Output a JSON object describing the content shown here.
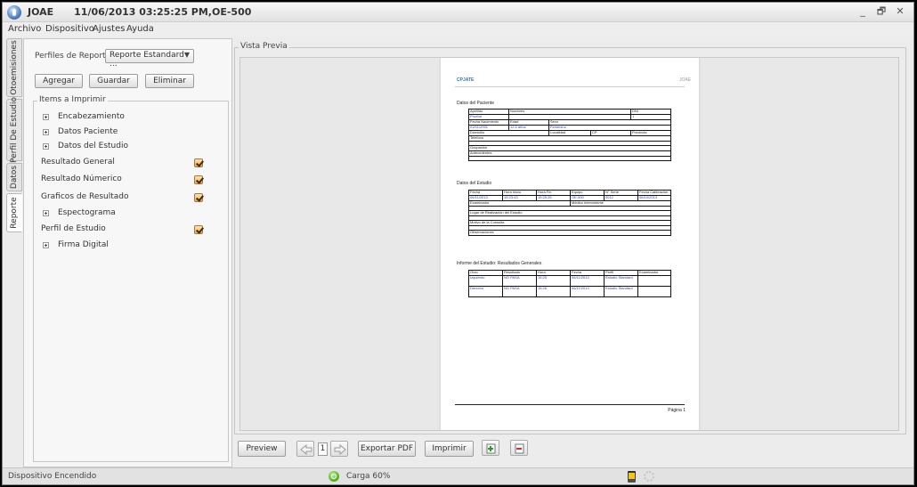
{
  "window": {
    "title": "JOAE      11/06/2013 03:25:25 PM,OE-500",
    "buttons": {
      "minimize": "_",
      "restore": "🗗",
      "close": "✕"
    }
  },
  "menu": [
    "Archivo",
    "Dispositivo",
    "Ajustes",
    "Ayuda"
  ],
  "side_tabs": [
    "Otoemisiones",
    "Perfil De Estudio",
    "Datos",
    "Reporte"
  ],
  "left_panel": {
    "profiles_label": "Perfiles de Reporte",
    "profile_selected": "Reporte Estandard ...",
    "buttons": {
      "add": "Agregar",
      "save": "Guardar",
      "delete": "Eliminar"
    },
    "items_group_title": "Items a Imprimir",
    "items": [
      {
        "label": "Encabezamiento",
        "type": "node"
      },
      {
        "label": "Datos Paciente",
        "type": "node"
      },
      {
        "label": "Datos del Estudio",
        "type": "node"
      },
      {
        "label": "Resultado General",
        "type": "check",
        "checked": true
      },
      {
        "label": "Resultado Númerico",
        "type": "check",
        "checked": true
      },
      {
        "label": "Graficos de Resultado",
        "type": "check",
        "checked": true
      },
      {
        "label": "Espectograma",
        "type": "node"
      },
      {
        "label": "Perfil de Estudio",
        "type": "check",
        "checked": true
      },
      {
        "label": "Firma Digital",
        "type": "node"
      }
    ]
  },
  "preview": {
    "title": "Vista Previa",
    "report": {
      "logo": "CPJATE",
      "logo_right": "JOAE",
      "patient_section": "Datos del Paciente",
      "patient": {
        "r1": [
          "Apellido",
          "Nombres",
          "DNI"
        ],
        "r2": [
          "Prueba",
          "",
          "1"
        ],
        "r3": [
          "Fecha Nacimiento",
          "Edad",
          "Sexo"
        ],
        "r4": [
          "01/01/2001",
          "12.5 años",
          "Femenino"
        ],
        "r5": [
          "Domicilio",
          "Localidad",
          "CP",
          "Provincia"
        ],
        "telefono": "Telefono",
        "ocupacion": "Ocupación",
        "antecedentes": "Antecedentes"
      },
      "study_section": "Datos del Estudio",
      "study": {
        "headers": [
          "Fecha",
          "Hora Inicio",
          "Hora Fin",
          "Equipo",
          "N° Serie",
          "Fecha Calibración"
        ],
        "values": [
          "06/11/2013",
          "15:23:43",
          "15:25:26",
          "OE-500",
          "0012",
          "06/10/2013"
        ],
        "examinador": "Examinador",
        "medico": "Médico Interviniente",
        "lugar": "Lugar de Realización del Estudio",
        "motivo": "Motivo de la Consulta",
        "observaciones": "Observaciones"
      },
      "results_section": "Informe del Estudio: Resultados Generales",
      "results": {
        "headers": [
          "Oído",
          "Resultado",
          "Hora",
          "Fecha",
          "Perfil",
          "Examinador"
        ],
        "rows": [
          [
            "Izquierdo",
            "NO PASA",
            "15:25",
            "06/11/2013",
            "Estudio Standard",
            ""
          ],
          [
            "Derecho",
            "NO PASA",
            "15:26",
            "06/11/2013",
            "Estudio Standard",
            ""
          ]
        ]
      },
      "page_label": "Página 1"
    }
  },
  "bottom": {
    "preview_button": "Preview",
    "page_number": "1",
    "export_pdf": "Exportar PDF",
    "print": "Imprimir"
  },
  "status": {
    "device": "Dispositivo Encendido",
    "charge": "Carga 60%"
  }
}
